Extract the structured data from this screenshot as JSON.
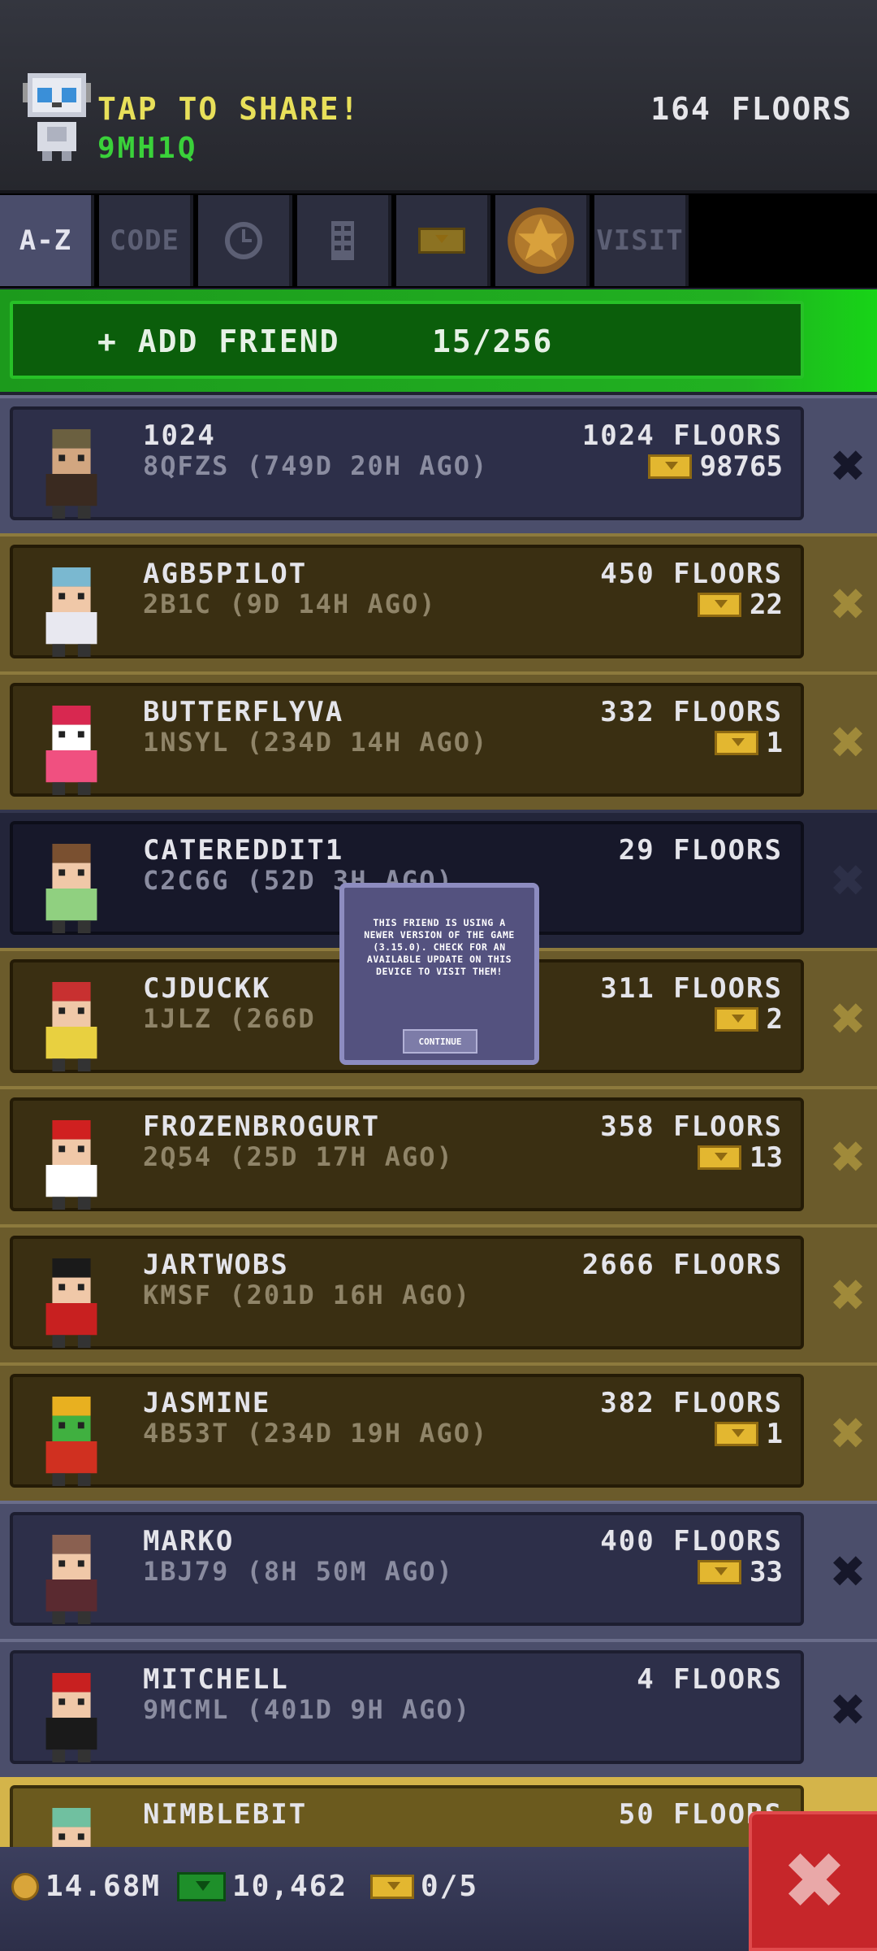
{
  "header": {
    "share_label": "TAP TO SHARE!",
    "share_code": "9MH1Q",
    "floors": "164 FLOORS"
  },
  "tabs": [
    {
      "label": "A-Z",
      "icon": null,
      "active": true
    },
    {
      "label": "CODE",
      "icon": null
    },
    {
      "label": "",
      "icon": "clock-icon"
    },
    {
      "label": "",
      "icon": "floor-building-icon"
    },
    {
      "label": "",
      "icon": "bux-icon"
    },
    {
      "label": "",
      "icon": "star-icon"
    },
    {
      "label": "VISIT",
      "icon": null
    }
  ],
  "add_friend": {
    "label": "+ ADD FRIEND",
    "count": "15/256"
  },
  "friends": [
    {
      "name": "1024",
      "sub": "8QFZS (749D 20H AGO)",
      "floors": "1024 FLOORS",
      "bux": "98765",
      "style": "blue"
    },
    {
      "name": "AGB5PILOT",
      "sub": "2B1C (9D 14H AGO)",
      "floors": "450 FLOORS",
      "bux": "22",
      "style": "gold"
    },
    {
      "name": "BUTTERFLYVA",
      "sub": "1NSYL (234D 14H AGO)",
      "floors": "332 FLOORS",
      "bux": "1",
      "style": "gold"
    },
    {
      "name": "CATEREDDIT1",
      "sub": "C2C6G (52D 3H AGO)",
      "floors": "29 FLOORS",
      "bux": null,
      "style": "dark"
    },
    {
      "name": "CJDUCKK",
      "sub": "1JLZ (266D",
      "floors": "311 FLOORS",
      "bux": "2",
      "style": "gold"
    },
    {
      "name": "FROZENBROGURT",
      "sub": "2Q54 (25D 17H AGO)",
      "floors": "358 FLOORS",
      "bux": "13",
      "style": "gold"
    },
    {
      "name": "JARTWOBS",
      "sub": "KMSF (201D 16H AGO)",
      "floors": "2666 FLOORS",
      "bux": null,
      "style": "gold"
    },
    {
      "name": "JASMINE",
      "sub": "4B53T (234D 19H AGO)",
      "floors": "382 FLOORS",
      "bux": "1",
      "style": "gold"
    },
    {
      "name": "MARKO",
      "sub": "1BJ79 (8H 50M AGO)",
      "floors": "400 FLOORS",
      "bux": "33",
      "style": "blue"
    },
    {
      "name": "MITCHELL",
      "sub": "9MCML (401D 9H AGO)",
      "floors": "4 FLOORS",
      "bux": null,
      "style": "blue"
    },
    {
      "name": "NIMBLEBIT",
      "sub": "",
      "floors": "50 FLOORS",
      "bux": null,
      "style": "bright"
    }
  ],
  "popup": {
    "message": "THIS FRIEND IS USING A NEWER VERSION OF THE GAME (3.15.0). CHECK FOR AN AVAILABLE UPDATE ON THIS DEVICE TO VISIT THEM!",
    "button": "CONTINUE"
  },
  "footer": {
    "coins": "14.68M",
    "bux": "10,462",
    "tickets": "0/5"
  },
  "colors": {
    "accent_green": "#21b121",
    "close_red": "#c6262a",
    "bux_gold": "#e3b730"
  }
}
